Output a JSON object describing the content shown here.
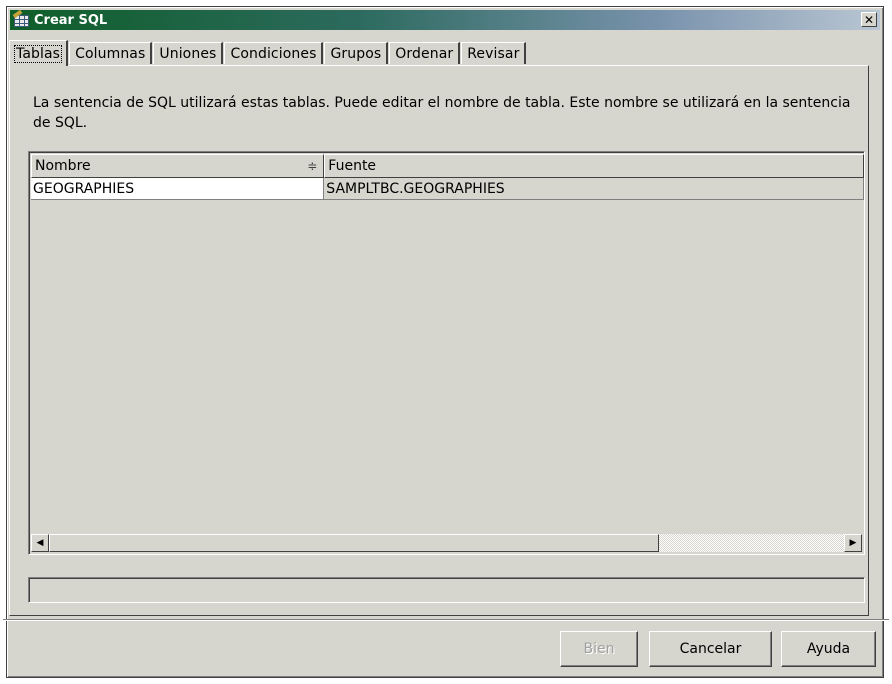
{
  "window": {
    "title": "Crear SQL",
    "close_glyph": "✕",
    "icon": "table-icon"
  },
  "tabs": [
    {
      "label": "Tablas",
      "active": true
    },
    {
      "label": "Columnas",
      "active": false
    },
    {
      "label": "Uniones",
      "active": false
    },
    {
      "label": "Condiciones",
      "active": false
    },
    {
      "label": "Grupos",
      "active": false
    },
    {
      "label": "Ordenar",
      "active": false
    },
    {
      "label": "Revisar",
      "active": false
    }
  ],
  "description": "La sentencia de SQL utilizará estas tablas. Puede editar el nombre de tabla. Este nombre se utilizará en la sentencia de SQL.",
  "table": {
    "columns": [
      "Nombre",
      "Fuente"
    ],
    "rows": [
      [
        "GEOGRAPHIES",
        "SAMPLTBC.GEOGRAPHIES"
      ]
    ],
    "sort_icon": "sort-icon"
  },
  "scrollbar": {
    "left_glyph": "◀",
    "right_glyph": "▶"
  },
  "buttons": {
    "ok": "Bien",
    "cancel": "Cancelar",
    "help": "Ayuda"
  },
  "colors": {
    "title_gradient_start": "#0e5e28",
    "title_gradient_end": "#b9c6d3",
    "window_bg": "#d6d6ce"
  }
}
